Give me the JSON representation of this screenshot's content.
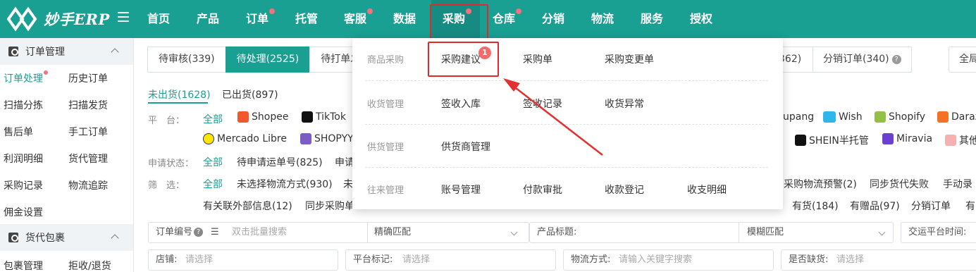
{
  "brand": {
    "name": "妙手ERP"
  },
  "nav": {
    "items": [
      {
        "label": "首页",
        "dot": false
      },
      {
        "label": "产品",
        "dot": false
      },
      {
        "label": "订单",
        "dot": true
      },
      {
        "label": "托管",
        "dot": false
      },
      {
        "label": "客服",
        "dot": true
      },
      {
        "label": "数据",
        "dot": false
      },
      {
        "label": "采购",
        "dot": true,
        "active": true
      },
      {
        "label": "仓库",
        "dot": true
      },
      {
        "label": "分销",
        "dot": false
      },
      {
        "label": "物流",
        "dot": false
      },
      {
        "label": "服务",
        "dot": false
      },
      {
        "label": "授权",
        "dot": false
      }
    ]
  },
  "sidebar": {
    "sections": [
      {
        "title": "订单管理",
        "links": [
          "订单处理",
          "历史订单",
          "扫描分拣",
          "扫描发货",
          "售后单",
          "手工订单",
          "利润明细",
          "货代管理",
          "采购记录",
          "物流追踪",
          "佣金设置"
        ]
      },
      {
        "title": "货代包裹",
        "links": [
          "包裹管理",
          "拒收/退货"
        ]
      }
    ]
  },
  "main": {
    "tabs": [
      "待审核(339)",
      "待处理(2525)",
      "待打单发"
    ],
    "tabs_right": {
      "partial": "362)",
      "distribution": "分销订单(340)"
    },
    "global_search": "全局",
    "subtabs": [
      "未出货(1628)",
      "已出货(897)"
    ],
    "platform_label": "平　台：",
    "all_label": "全部",
    "platforms_left": [
      "Shopee",
      "TikTok",
      "Mercado Libre",
      "SHOPYY"
    ],
    "platforms_right": [
      "upang",
      "Wish",
      "Shopify",
      "Daraz",
      "SHEIN半托管",
      "Miravia",
      "其他"
    ],
    "apply_label": "申请状态：",
    "apply_items": [
      "全部",
      "待申请运单号(825)",
      "申请"
    ],
    "filter_label": "筛　选：",
    "filter_items": [
      "全部",
      "未选择物流方式(930)",
      "未"
    ],
    "filter_right": [
      "采购物流预警(2)",
      "同步货代失败",
      "手动录"
    ],
    "filter_row2_left": [
      "有关联外部信息(12)",
      "同步采购单"
    ],
    "filter_row2_right": [
      "有货(184)",
      "有赠品(97)",
      "分销订单",
      "有"
    ],
    "search_row1": {
      "order_label": "订单编号",
      "order_placeholder": "双击批量搜索",
      "match1": "精确匹配",
      "product_title_label": "产品标题:",
      "match2": "模糊匹配",
      "trade_time_label": "交运平台时间:"
    },
    "search_row2": {
      "shop_label": "店铺:",
      "shop_placeholder": "请选择",
      "mark_label": "平台标记:",
      "mark_placeholder": "请选择",
      "logistics_label": "物流方式:",
      "logistics_placeholder": "请输入关键字搜索",
      "stock_label": "是否缺货:",
      "stock_placeholder": "请选择"
    }
  },
  "dropdown": {
    "groups": [
      {
        "label": "商品采购",
        "items": [
          "采购建议",
          "采购单",
          "采购变更单"
        ]
      },
      {
        "label": "收货管理",
        "items": [
          "签收入库",
          "签收记录",
          "收货异常"
        ]
      },
      {
        "label": "供货管理",
        "items": [
          "供货商管理"
        ]
      },
      {
        "label": "往来管理",
        "items": [
          "账号管理",
          "付款审批",
          "收款登记",
          "收支明细"
        ]
      }
    ],
    "badge": "1"
  },
  "colors": {
    "brand": "#1a9f93",
    "highlight": "#e02a2a",
    "badge": "#f46a6a"
  }
}
